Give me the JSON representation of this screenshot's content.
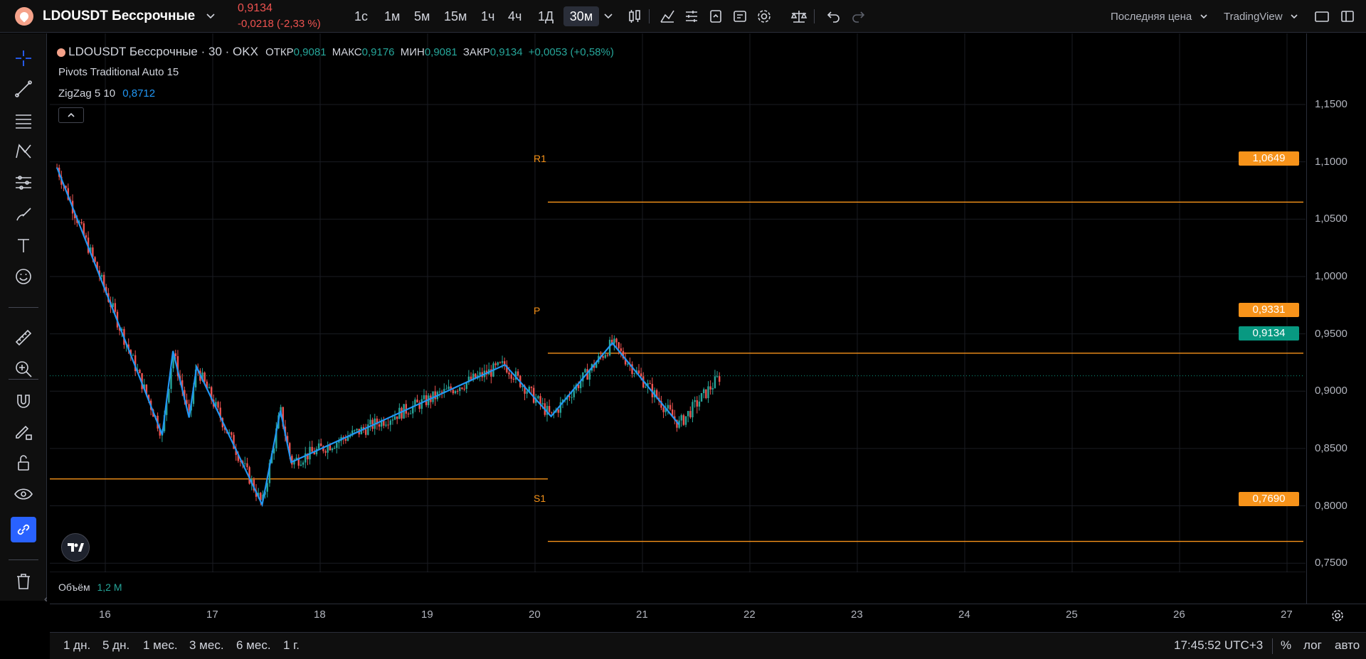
{
  "header": {
    "symbol": "LDOUSDT Бессрочные",
    "price": "0,9134",
    "change": "-0,0218 (-2,33 %)",
    "intervals": [
      "1с",
      "1м",
      "5м",
      "15м",
      "1ч",
      "4ч",
      "1Д",
      "30м"
    ],
    "price_type": "Последняя цена",
    "provider": "TradingView"
  },
  "legend": {
    "title": "LDOUSDT Бессрочные · 30 · OKX",
    "open_label": "ОТКР",
    "open": "0,9081",
    "high_label": "МАКС",
    "high": "0,9176",
    "low_label": "МИН",
    "low": "0,9081",
    "close_label": "ЗАКР",
    "close": "0,9134",
    "change": "+0,0053 (+0,58%)",
    "pivots": "Pivots Traditional Auto 15",
    "zigzag": "ZigZag 5 10",
    "zigzag_value": "0,8712",
    "volume_label": "Объём",
    "volume_value": "1,2 M"
  },
  "pivot_labels": {
    "r1": "R1",
    "p": "P",
    "s1": "S1"
  },
  "price_labels": {
    "r1": "1,0649",
    "p": "0,9331",
    "last": "0,9134",
    "s1": "0,7690"
  },
  "bottom": {
    "ranges": [
      "1 дн.",
      "5 дн.",
      "1 мес.",
      "3 мес.",
      "6 мес.",
      "1 г."
    ],
    "time": "17:45:52 UTC+3",
    "percent": "%",
    "log": "лог",
    "auto": "авто"
  },
  "colors": {
    "up": "#26a69a",
    "down": "#ef5350",
    "zigzag": "#2196f3",
    "pivot": "#f7931a",
    "last": "#089981"
  },
  "chart_data": {
    "type": "candlestick",
    "y_axis_ticks": [
      "1,1500",
      "1,1000",
      "1,0500",
      "1,0000",
      "0,9500",
      "0,9000",
      "0,8500",
      "0,8000",
      "0,7500"
    ],
    "x_axis_ticks": [
      "16",
      "17",
      "18",
      "19",
      "20",
      "21",
      "22",
      "23",
      "24",
      "25",
      "26",
      "27"
    ],
    "ylim": [
      0.72,
      1.17
    ],
    "pivots": {
      "R1": 1.0649,
      "P": 0.9331,
      "S1": 0.769,
      "S1_previous": 0.8235
    },
    "last_price": 0.9134,
    "zigzag_points": [
      {
        "x": 15.55,
        "y": 1.095
      },
      {
        "x": 16.53,
        "y": 0.862
      },
      {
        "x": 16.63,
        "y": 0.935
      },
      {
        "x": 16.78,
        "y": 0.877
      },
      {
        "x": 16.85,
        "y": 0.921
      },
      {
        "x": 17.46,
        "y": 0.801
      },
      {
        "x": 17.63,
        "y": 0.883
      },
      {
        "x": 17.73,
        "y": 0.838
      },
      {
        "x": 19.72,
        "y": 0.923
      },
      {
        "x": 20.15,
        "y": 0.878
      },
      {
        "x": 20.72,
        "y": 0.942
      },
      {
        "x": 21.34,
        "y": 0.871
      }
    ]
  }
}
